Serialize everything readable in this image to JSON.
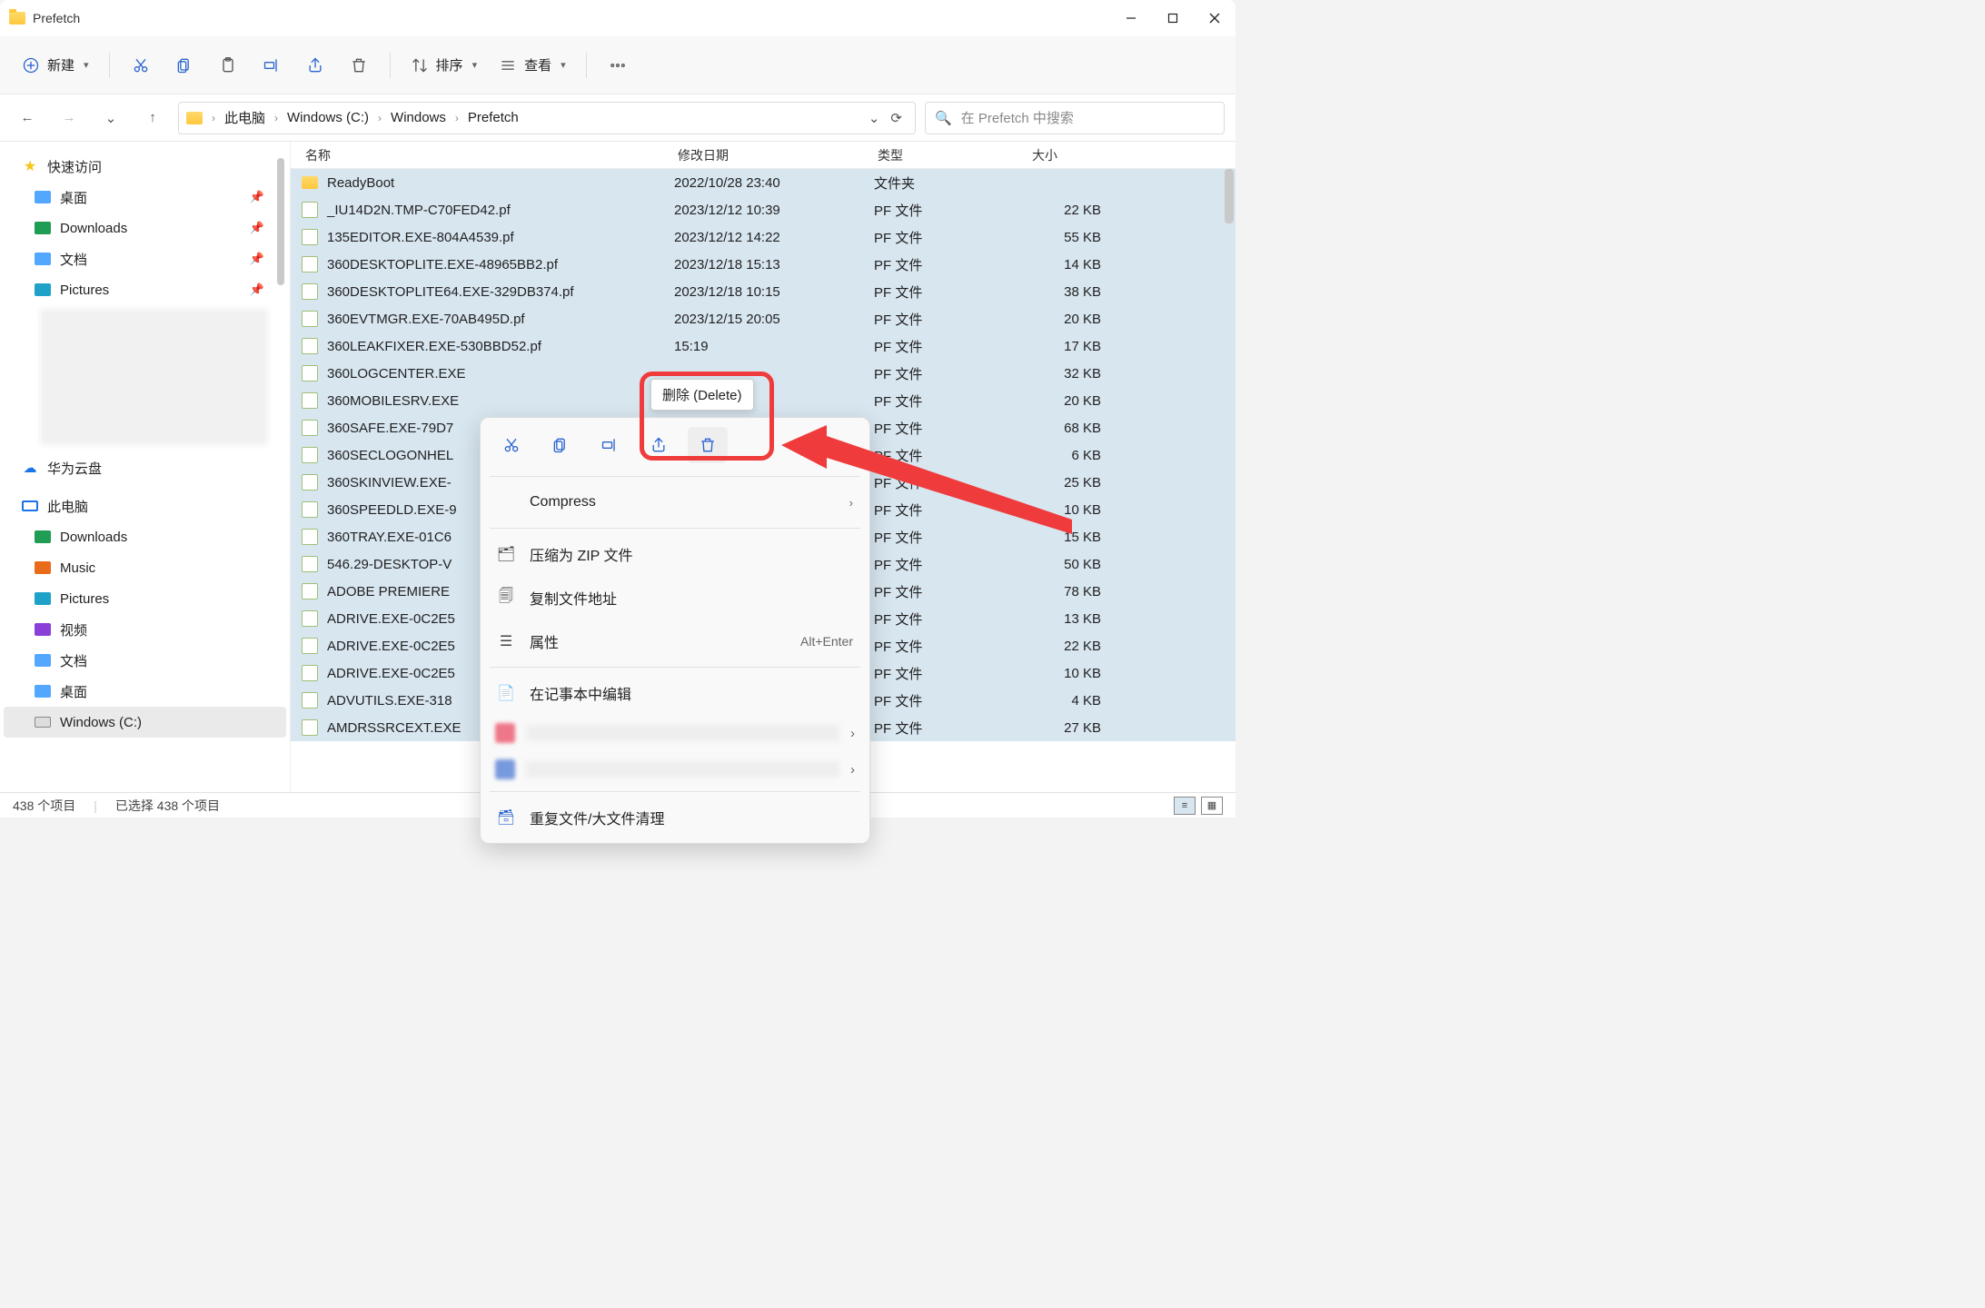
{
  "window": {
    "title": "Prefetch"
  },
  "toolbar": {
    "new": "新建",
    "sort": "排序",
    "view": "查看"
  },
  "breadcrumb": {
    "parts": [
      "此电脑",
      "Windows (C:)",
      "Windows",
      "Prefetch"
    ]
  },
  "search": {
    "placeholder": "在 Prefetch 中搜索"
  },
  "sidebar": {
    "quick": "快速访问",
    "desktop": "桌面",
    "downloads": "Downloads",
    "documents": "文档",
    "pictures": "Pictures",
    "hwcloud": "华为云盘",
    "thispc": "此电脑",
    "downloads2": "Downloads",
    "music": "Music",
    "pictures2": "Pictures",
    "video": "视频",
    "documents2": "文档",
    "desktop2": "桌面",
    "drive_c": "Windows (C:)"
  },
  "columns": {
    "name": "名称",
    "date": "修改日期",
    "type": "类型",
    "size": "大小"
  },
  "type_folder": "文件夹",
  "type_pf": "PF 文件",
  "files": [
    {
      "name": "ReadyBoot",
      "date": "2022/10/28 23:40",
      "type_key": "type_folder",
      "size": "",
      "folder": true
    },
    {
      "name": "_IU14D2N.TMP-C70FED42.pf",
      "date": "2023/12/12 10:39",
      "type_key": "type_pf",
      "size": "22 KB"
    },
    {
      "name": "135EDITOR.EXE-804A4539.pf",
      "date": "2023/12/12 14:22",
      "type_key": "type_pf",
      "size": "55 KB"
    },
    {
      "name": "360DESKTOPLITE.EXE-48965BB2.pf",
      "date": "2023/12/18 15:13",
      "type_key": "type_pf",
      "size": "14 KB"
    },
    {
      "name": "360DESKTOPLITE64.EXE-329DB374.pf",
      "date": "2023/12/18 10:15",
      "type_key": "type_pf",
      "size": "38 KB"
    },
    {
      "name": "360EVTMGR.EXE-70AB495D.pf",
      "date": "2023/12/15 20:05",
      "type_key": "type_pf",
      "size": "20 KB"
    },
    {
      "name": "360LEAKFIXER.EXE-530BBD52.pf",
      "date": "15:19",
      "type_key": "type_pf",
      "size": "17 KB"
    },
    {
      "name": "360LOGCENTER.EXE",
      "date": "",
      "type_key": "type_pf",
      "size": "32 KB"
    },
    {
      "name": "360MOBILESRV.EXE",
      "date": "",
      "type_key": "type_pf",
      "size": "20 KB"
    },
    {
      "name": "360SAFE.EXE-79D7",
      "date": "",
      "type_key": "type_pf",
      "size": "68 KB"
    },
    {
      "name": "360SECLOGONHEL",
      "date": "",
      "type_key": "type_pf",
      "size": "6 KB"
    },
    {
      "name": "360SKINVIEW.EXE-",
      "date": "",
      "type_key": "type_pf",
      "size": "25 KB"
    },
    {
      "name": "360SPEEDLD.EXE-9",
      "date": "",
      "type_key": "type_pf",
      "size": "10 KB"
    },
    {
      "name": "360TRAY.EXE-01C6",
      "date": "",
      "type_key": "type_pf",
      "size": "15 KB"
    },
    {
      "name": "546.29-DESKTOP-V",
      "date": "",
      "type_key": "type_pf",
      "size": "50 KB"
    },
    {
      "name": "ADOBE PREMIERE",
      "date": "",
      "type_key": "type_pf",
      "size": "78 KB"
    },
    {
      "name": "ADRIVE.EXE-0C2E5",
      "date": "",
      "type_key": "type_pf",
      "size": "13 KB"
    },
    {
      "name": "ADRIVE.EXE-0C2E5",
      "date": "",
      "type_key": "type_pf",
      "size": "22 KB"
    },
    {
      "name": "ADRIVE.EXE-0C2E5",
      "date": "",
      "type_key": "type_pf",
      "size": "10 KB"
    },
    {
      "name": "ADVUTILS.EXE-318",
      "date": "",
      "type_key": "type_pf",
      "size": "4 KB"
    },
    {
      "name": "AMDRSSRCEXT.EXE",
      "date": "",
      "type_key": "type_pf",
      "size": "27 KB"
    }
  ],
  "context_menu": {
    "tooltip": "删除 (Delete)",
    "compress": "Compress",
    "zip": "压缩为 ZIP 文件",
    "copy_path": "复制文件地址",
    "properties": "属性",
    "properties_kbd": "Alt+Enter",
    "notepad": "在记事本中编辑",
    "dup_clean": "重复文件/大文件清理"
  },
  "status": {
    "count": "438 个项目",
    "selected": "已选择 438 个项目"
  }
}
